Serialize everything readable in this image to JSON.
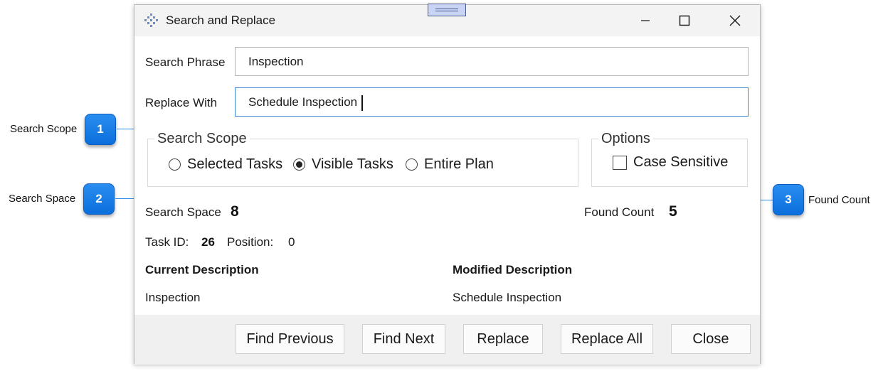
{
  "window": {
    "title": "Search and Replace"
  },
  "form": {
    "search_phrase_label": "Search Phrase",
    "search_phrase_value": "Inspection",
    "replace_with_label": "Replace With",
    "replace_with_value": "Schedule Inspection"
  },
  "search_scope": {
    "title": "Search Scope",
    "options": [
      {
        "label": "Selected Tasks",
        "selected": false
      },
      {
        "label": "Visible Tasks",
        "selected": true
      },
      {
        "label": "Entire Plan",
        "selected": false
      }
    ]
  },
  "options_group": {
    "title": "Options",
    "case_sensitive_label": "Case Sensitive",
    "case_sensitive_checked": false
  },
  "stats": {
    "search_space_label": "Search Space",
    "search_space_value": "8",
    "found_count_label": "Found Count",
    "found_count_value": "5",
    "task_id_label": "Task ID:",
    "task_id_value": "26",
    "position_label": "Position:",
    "position_value": "0"
  },
  "descriptions": {
    "current_header": "Current Description",
    "current_value": "Inspection",
    "modified_header": "Modified Description",
    "modified_value": "Schedule Inspection"
  },
  "buttons": {
    "find_previous": "Find Previous",
    "find_next": "Find Next",
    "replace": "Replace",
    "replace_all": "Replace All",
    "close": "Close"
  },
  "callouts": [
    {
      "number": "1",
      "label": "Search Scope"
    },
    {
      "number": "2",
      "label": "Search Space"
    },
    {
      "number": "3",
      "label": "Found Count"
    }
  ],
  "colors": {
    "callout_blue": "#1a7fe8",
    "focus_border": "#3d86d4"
  }
}
